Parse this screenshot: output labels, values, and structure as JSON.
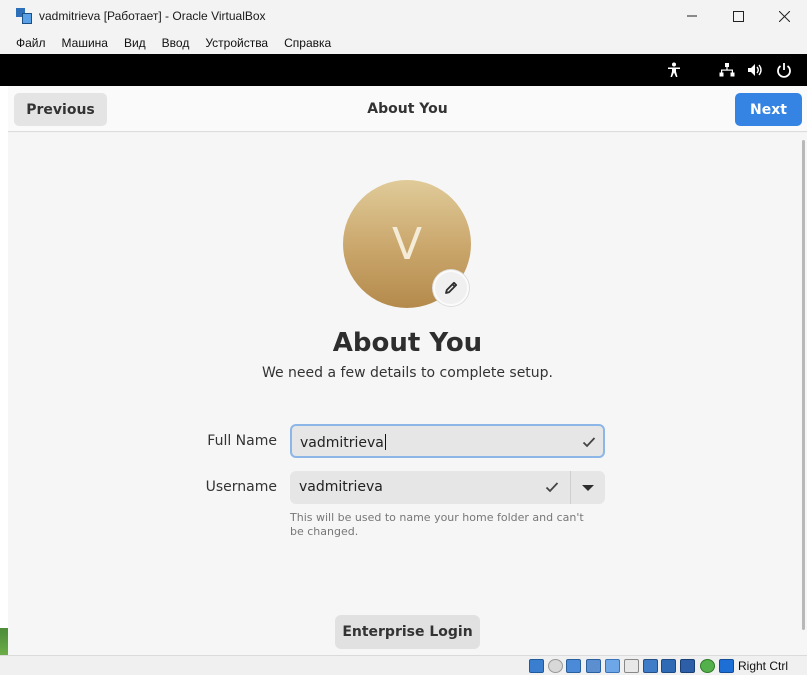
{
  "window": {
    "title": "vadmitrieva [Работает] - Oracle VirtualBox"
  },
  "menu": {
    "items": [
      {
        "label": "Файл"
      },
      {
        "label": "Машина"
      },
      {
        "label": "Вид"
      },
      {
        "label": "Ввод"
      },
      {
        "label": "Устройства"
      },
      {
        "label": "Справка"
      }
    ]
  },
  "topbar": {
    "icons": [
      "accessibility-icon",
      "network-icon",
      "volume-icon",
      "power-icon"
    ]
  },
  "header": {
    "previous_label": "Previous",
    "title": "About You",
    "next_label": "Next"
  },
  "avatar": {
    "initial": "V"
  },
  "page": {
    "title": "About You",
    "subtitle": "We need a few details to complete setup."
  },
  "form": {
    "fullname_label": "Full Name",
    "fullname_value": "vadmitrieva",
    "username_label": "Username",
    "username_value": "vadmitrieva",
    "username_hint": "This will be used to name your home folder and can't be changed."
  },
  "enterprise_label": "Enterprise Login",
  "statusbar": {
    "host_key": "Right Ctrl"
  },
  "colors": {
    "accent": "#3584e4",
    "focus_border": "#8db6e8"
  }
}
